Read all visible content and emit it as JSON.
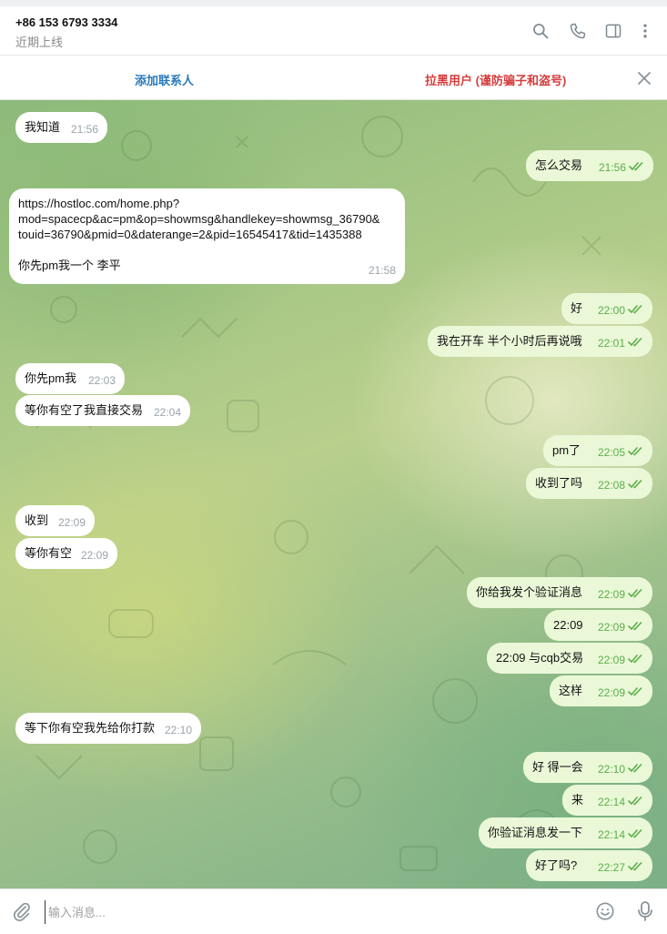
{
  "header": {
    "peer_name": "+86 153 6793 3334",
    "peer_status": "近期上线",
    "icons": [
      "search-icon",
      "phone-icon",
      "sidebar-icon",
      "more-icon"
    ]
  },
  "action_bar": {
    "add_contact": "添加联系人",
    "block_user": "拉黑用户 (谨防骗子和盗号)",
    "close_icon": "close-icon"
  },
  "messages": [
    {
      "dir": "in",
      "text": "我知道",
      "time": "21:56"
    },
    {
      "dir": "out",
      "text": "怎么交易",
      "time": "21:56"
    },
    {
      "dir": "in",
      "text": "https://hostloc.com/home.php?\nmod=spacecp&ac=pm&op=showmsg&handlekey=showmsg_36790&\ntouid=36790&pmid=0&daterange=2&pid=16545417&tid=1435388\n\n你先pm我一个 李平",
      "time": "21:58"
    },
    {
      "dir": "out",
      "text": "好",
      "time": "22:00"
    },
    {
      "dir": "out",
      "text": "我在开车 半个小时后再说哦",
      "time": "22:01"
    },
    {
      "dir": "in",
      "text": "你先pm我",
      "time": "22:03"
    },
    {
      "dir": "in",
      "text": "等你有空了我直接交易",
      "time": "22:04"
    },
    {
      "dir": "out",
      "text": "pm了",
      "time": "22:05"
    },
    {
      "dir": "out",
      "text": "收到了吗",
      "time": "22:08"
    },
    {
      "dir": "in",
      "text": "收到",
      "time": "22:09"
    },
    {
      "dir": "in",
      "text": "等你有空",
      "time": "22:09"
    },
    {
      "dir": "out",
      "text": "你给我发个验证消息",
      "time": "22:09"
    },
    {
      "dir": "out",
      "text": "22:09",
      "time": "22:09"
    },
    {
      "dir": "out",
      "text": "22:09 与cqb交易",
      "time": "22:09"
    },
    {
      "dir": "out",
      "text": "这样",
      "time": "22:09"
    },
    {
      "dir": "in",
      "text": "等下你有空我先给你打款",
      "time": "22:10"
    },
    {
      "dir": "out",
      "text": "好 得一会",
      "time": "22:10"
    },
    {
      "dir": "out",
      "text": "来",
      "time": "22:14"
    },
    {
      "dir": "out",
      "text": "你验证消息发一下",
      "time": "22:14"
    },
    {
      "dir": "out",
      "text": "好了吗?",
      "time": "22:27"
    }
  ],
  "composer": {
    "placeholder": "输入消息...",
    "icons": [
      "attach-icon",
      "emoji-icon",
      "microphone-icon"
    ]
  },
  "colors": {
    "incoming_bubble": "#ffffff",
    "outgoing_bubble": "#eaf8d8",
    "read_check": "#5cae4a",
    "add_contact": "#2a7ab8",
    "block_user": "#d43c3c"
  }
}
